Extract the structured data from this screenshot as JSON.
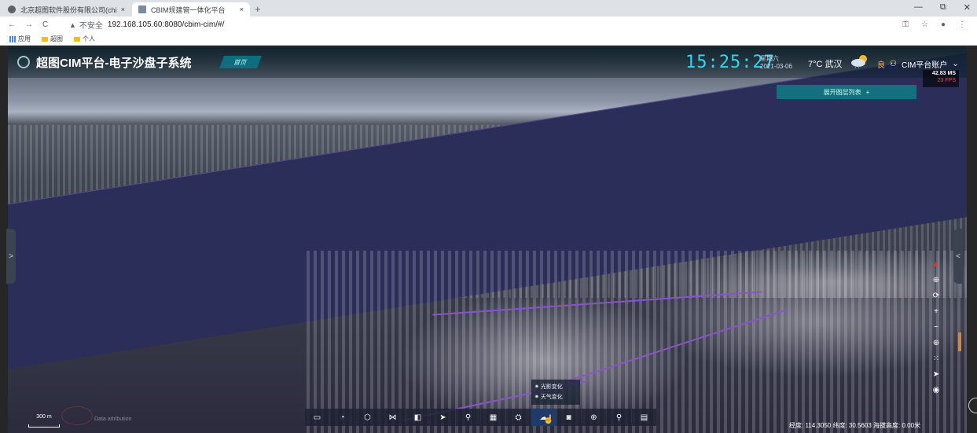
{
  "browser": {
    "tabs": [
      {
        "title": "北京超图软件股份有限公司(chi",
        "close": "×"
      },
      {
        "title": "CBIM规建管一体化平台",
        "close": "×"
      }
    ],
    "new_tab": "+",
    "window_controls": [
      "—",
      "⧉",
      "✕"
    ],
    "nav": [
      "←",
      "→",
      "C"
    ],
    "security_label": "不安全",
    "url": "192.168.105.60:8080/cbim-cim/#/",
    "right_icons": [
      "⚿",
      "☆",
      "●",
      "⋮"
    ],
    "bookmarks": [
      "应用",
      "超图",
      "个人"
    ]
  },
  "header": {
    "title": "超图CIM平台-电子沙盘子系统",
    "home_label": "首页",
    "time": "15:25:27",
    "weekday": "星期六",
    "date": "2021-03-06",
    "weather_text": "7°C 武汉",
    "air_quality": "良",
    "account": "CIM平台账户",
    "account_caret": "⌄"
  },
  "fps": {
    "ms": "42.83 MS",
    "fps": "23 FPS"
  },
  "layer_button": {
    "label": "展开图层列表",
    "plus": "+"
  },
  "side_handles": {
    "left": ">",
    "right": "<"
  },
  "right_controls": [
    "▲",
    "⊕",
    "⟳",
    "+",
    "−",
    "⊕",
    "⁙",
    "➤",
    "◉"
  ],
  "scale": {
    "label": "300 m"
  },
  "attribution": "Data attribution",
  "toolbar": [
    "▭",
    "◔",
    "⬡",
    "⋈",
    "◧",
    "➤",
    "⚲",
    "▦",
    "⛭",
    "☁",
    "◙",
    "⊕",
    "⚲",
    "▤"
  ],
  "popup": {
    "items": [
      "光影变化",
      "天气变化"
    ]
  },
  "coords": "经度: 114.3050 纬度: 30.5603 海拔高度: 0.00米"
}
